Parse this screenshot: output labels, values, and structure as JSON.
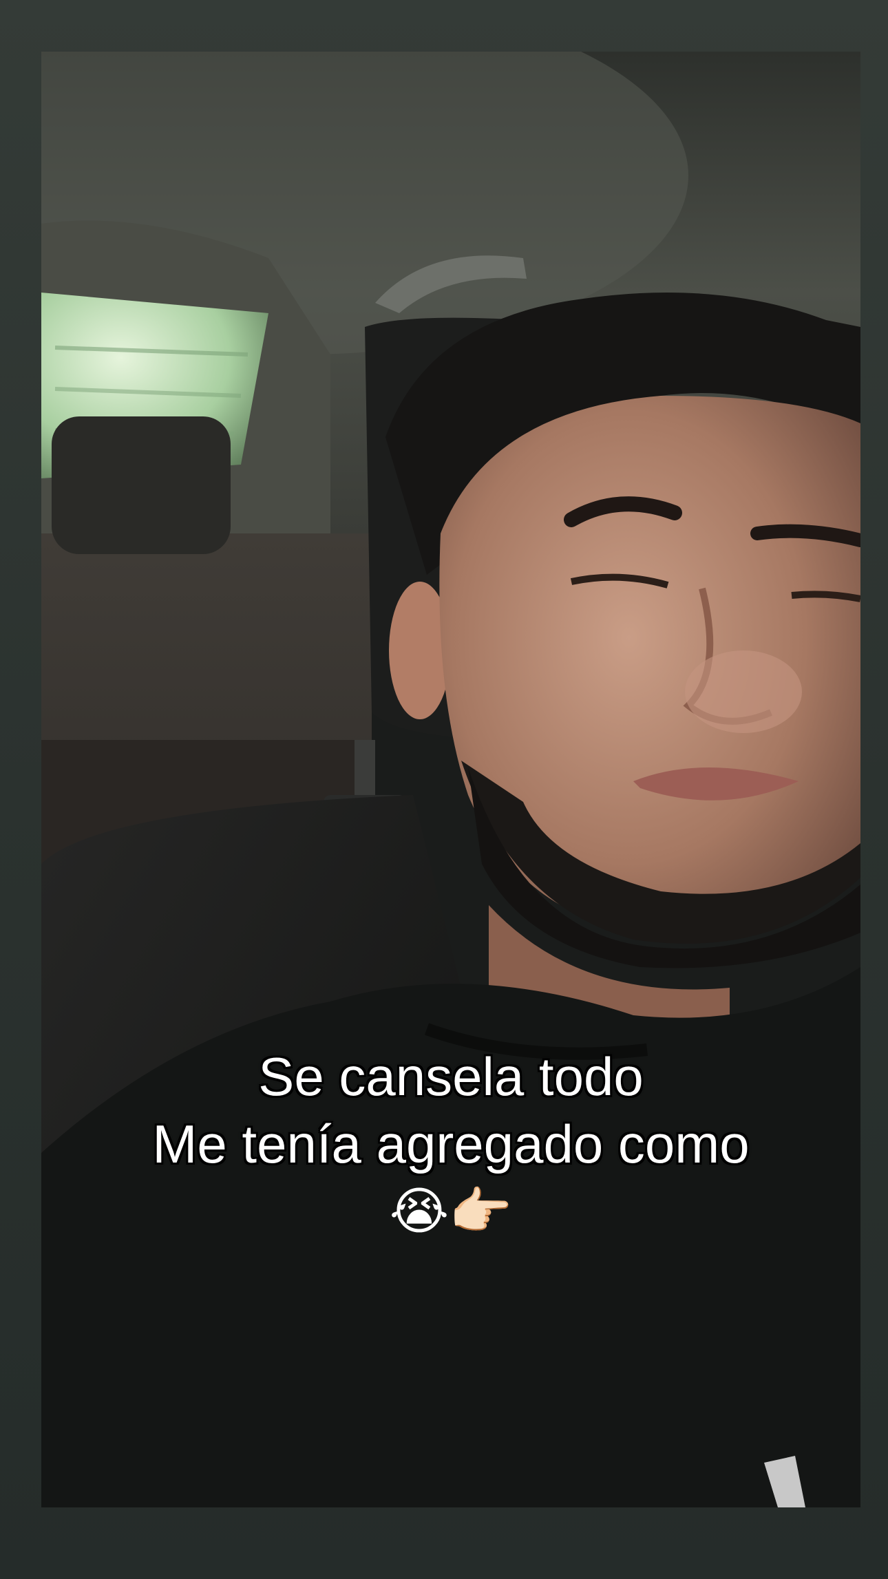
{
  "caption": {
    "line1": "Se cansela todo",
    "line2": "Me tenía agregado como",
    "line3": "😭👉🏻"
  },
  "colors": {
    "frame": "#2e3432",
    "caption_text": "#ffffff",
    "caption_outline": "#000000",
    "shirt": "#141615",
    "headliner": "#4a4d46",
    "window_glow": "#a9cfa3"
  },
  "scene": {
    "subject": "selfie-in-car",
    "icons": [
      "crying-face-emoji",
      "pointing-right-emoji"
    ]
  }
}
